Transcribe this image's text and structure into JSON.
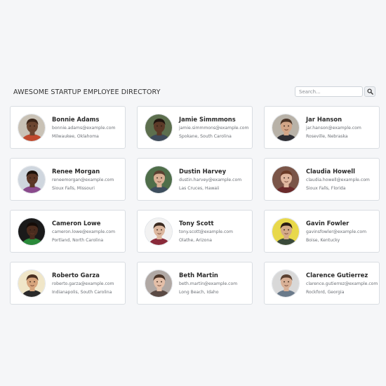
{
  "header": {
    "title": "AWESOME STARTUP EMPLOYEE DIRECTORY",
    "search_placeholder": "Search...",
    "search_icon": "magnifier-icon"
  },
  "employees": [
    {
      "name": "Bonnie Adams",
      "email": "bonnie.adams@example.com",
      "location": "Milwaukee, Oklahoma",
      "skin": "#6b4530",
      "hair": "#3a2418",
      "bg": "#c9c2b6",
      "shirt": "#c04a2e"
    },
    {
      "name": "Jamie Simmmons",
      "email": "jamie.simmmons@example.com",
      "location": "Spokane, South Carolina",
      "skin": "#5c3a28",
      "hair": "#1e140e",
      "bg": "#5d6f4e",
      "shirt": "#3e4a5a"
    },
    {
      "name": "Jar Hanson",
      "email": "jar.hanson@example.com",
      "location": "Roseville, Nebraska",
      "skin": "#d2a587",
      "hair": "#4a3326",
      "bg": "#b8b2a8",
      "shirt": "#2d2d33"
    },
    {
      "name": "Renee Morgan",
      "email": "reneemorgan@example.com",
      "location": "Sioux Falls, Missouri",
      "skin": "#5a3626",
      "hair": "#1c120c",
      "bg": "#cfd6de",
      "shirt": "#8a4a8c"
    },
    {
      "name": "Dustin Harvey",
      "email": "dustin.harvey@example.com",
      "location": "Las Cruces, Hawaii",
      "skin": "#d8b095",
      "hair": "#5a4030",
      "bg": "#4f6e4a",
      "shirt": "#3d4e5e"
    },
    {
      "name": "Claudia Howell",
      "email": "claudia.howell@example.com",
      "location": "Sioux Falls, Florida",
      "skin": "#e0b8a0",
      "hair": "#6a3a26",
      "bg": "#7a5548",
      "shirt": "#6a2a2a"
    },
    {
      "name": "Cameron Lowe",
      "email": "cameron.lowe@example.com",
      "location": "Portland, North Carolina",
      "skin": "#4a2c1e",
      "hair": "#140c08",
      "bg": "#1a1a1a",
      "shirt": "#2a8a3a"
    },
    {
      "name": "Tony Scott",
      "email": "tony.scott@example.com",
      "location": "Olathe, Arizona",
      "skin": "#dcb79e",
      "hair": "#3a2a20",
      "bg": "#f2f2f2",
      "shirt": "#8a2a3a"
    },
    {
      "name": "Gavin Fowler",
      "email": "gavinsfowler@example.com",
      "location": "Boise, Kentucky",
      "skin": "#d4aa88",
      "hair": "#2a1c14",
      "bg": "#e8d84a",
      "shirt": "#3a4a3a"
    },
    {
      "name": "Roberto Garza",
      "email": "roberto.garza@example.com",
      "location": "Indianapolis, South Carolina",
      "skin": "#d6a47c",
      "hair": "#4a3020",
      "bg": "#f0e6c8",
      "shirt": "#2a2a2a"
    },
    {
      "name": "Beth Martin",
      "email": "beth.martin@example.com",
      "location": "Long Beach, Idaho",
      "skin": "#e4bfa8",
      "hair": "#4a3326",
      "bg": "#b0a8a4",
      "shirt": "#5a4a44"
    },
    {
      "name": "Clarence Gutierrez",
      "email": "clarence.gutierrez@example.com",
      "location": "Rockford, Georgia",
      "skin": "#d8b096",
      "hair": "#5a4030",
      "bg": "#d8d8d8",
      "shirt": "#6a7a8a"
    }
  ]
}
